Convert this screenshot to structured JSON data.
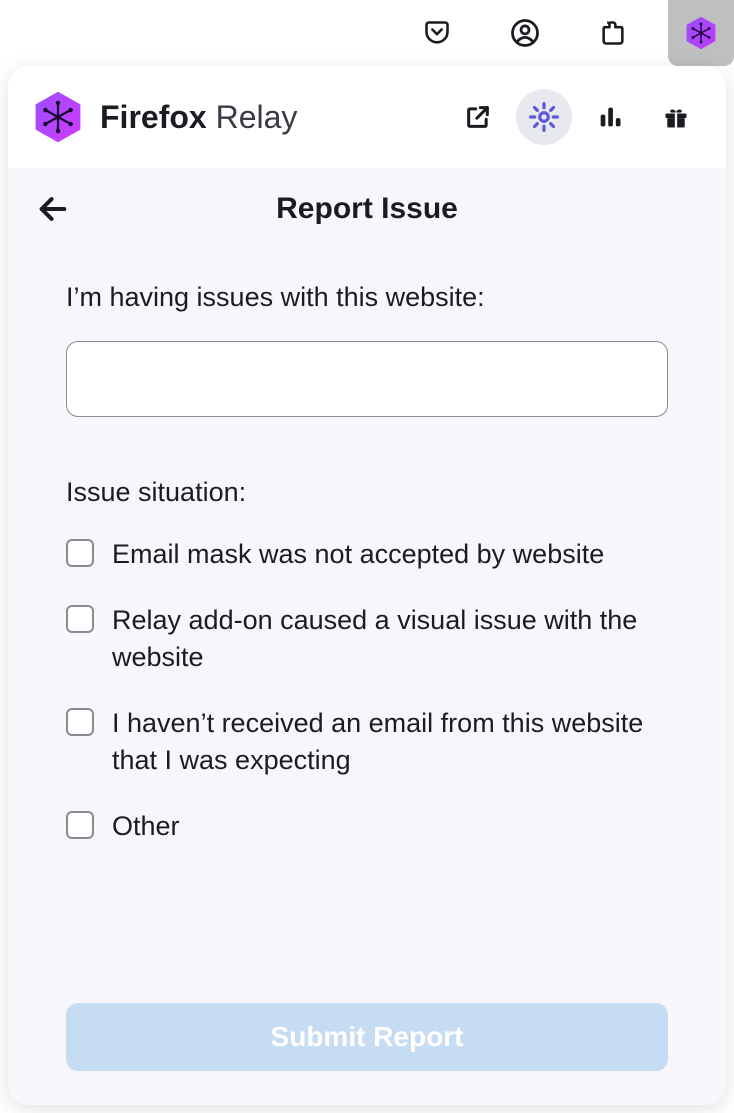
{
  "toolbar": {
    "icons": [
      "pocket-icon",
      "account-icon",
      "extensions-icon",
      "relay-icon"
    ]
  },
  "header": {
    "brand_strong": "Firefox",
    "brand_light": " Relay"
  },
  "page": {
    "title": "Report Issue",
    "website_label": "I’m having issues with this website:",
    "website_value": "",
    "situation_label": "Issue situation:",
    "options": [
      "Email mask was not accepted by website",
      "Relay add-on caused a visual issue with the website",
      "I haven’t received an email from this website that I was expecting",
      "Other"
    ],
    "submit_label": "Submit Report"
  },
  "colors": {
    "accent": "#5b5bd6",
    "submit_bg": "#c6dcf2"
  }
}
